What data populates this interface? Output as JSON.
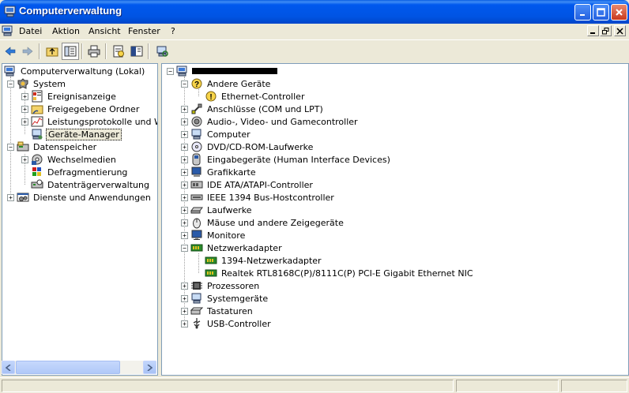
{
  "window": {
    "title": "Computerverwaltung",
    "controls": [
      "minimize-icon",
      "maximize-icon",
      "close-icon"
    ]
  },
  "menu": {
    "items": [
      "Datei",
      "Aktion",
      "Ansicht",
      "Fenster",
      "?"
    ]
  },
  "toolbar": {
    "buttons": [
      "back-icon",
      "forward-icon",
      "up-folder-icon",
      "show-hide-tree-icon",
      "print-icon",
      "properties-icon",
      "help-view-icon",
      "scan-hardware-icon"
    ]
  },
  "left_tree": {
    "root": "Computerverwaltung (Lokal)",
    "system": "System",
    "ereignisanzeige": "Ereignisanzeige",
    "freigegebene": "Freigegebene Ordner",
    "leistung": "Leistungsprotokolle und War",
    "geraete": "Geräte-Manager",
    "datenspeicher": "Datenspeicher",
    "wechselmedien": "Wechselmedien",
    "defrag": "Defragmentierung",
    "datentraeger": "Datenträgerverwaltung",
    "dienste": "Dienste und Anwendungen"
  },
  "device_tree": {
    "root_label": "",
    "categories": [
      {
        "label": "Andere Geräte",
        "expanded": true,
        "icon": "unknown-device-icon"
      },
      {
        "label": "Ethernet-Controller",
        "child": true,
        "icon": "warning-device-icon"
      },
      {
        "label": "Anschlüsse (COM und LPT)",
        "icon": "port-icon"
      },
      {
        "label": "Audio-, Video- und Gamecontroller",
        "icon": "audio-icon"
      },
      {
        "label": "Computer",
        "icon": "computer-icon"
      },
      {
        "label": "DVD/CD-ROM-Laufwerke",
        "icon": "cdrom-icon"
      },
      {
        "label": "Eingabegeräte (Human Interface Devices)",
        "icon": "hid-icon"
      },
      {
        "label": "Grafikkarte",
        "icon": "display-adapter-icon"
      },
      {
        "label": "IDE ATA/ATAPI-Controller",
        "icon": "ide-controller-icon"
      },
      {
        "label": "IEEE 1394 Bus-Hostcontroller",
        "icon": "firewire-icon"
      },
      {
        "label": "Laufwerke",
        "icon": "disk-drive-icon"
      },
      {
        "label": "Mäuse und andere Zeigegeräte",
        "icon": "mouse-icon"
      },
      {
        "label": "Monitore",
        "icon": "monitor-icon"
      },
      {
        "label": "Netzwerkadapter",
        "expanded": true,
        "icon": "network-adapter-icon"
      },
      {
        "label": "1394-Netzwerkadapter",
        "child": true,
        "icon": "network-adapter-icon"
      },
      {
        "label": "Realtek RTL8168C(P)/8111C(P) PCI-E Gigabit Ethernet NIC",
        "child": true,
        "icon": "network-adapter-icon"
      },
      {
        "label": "Prozessoren",
        "icon": "processor-icon"
      },
      {
        "label": "Systemgeräte",
        "icon": "system-device-icon"
      },
      {
        "label": "Tastaturen",
        "icon": "keyboard-icon"
      },
      {
        "label": "USB-Controller",
        "icon": "usb-icon"
      }
    ]
  }
}
